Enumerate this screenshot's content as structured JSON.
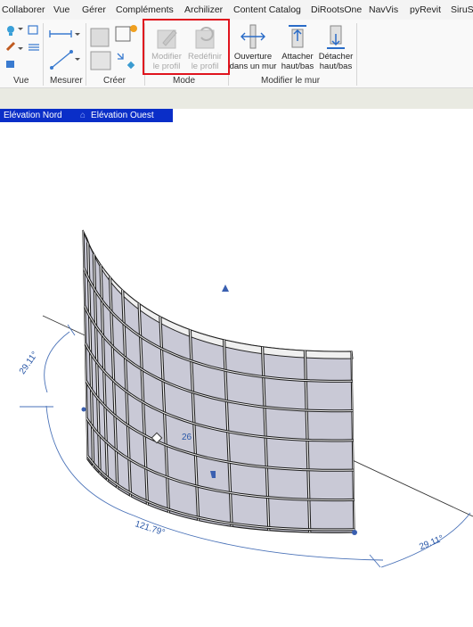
{
  "menu": [
    "Collaborer",
    "Vue",
    "Gérer",
    "Compléments",
    "Archilizer",
    "Content Catalog",
    "DiRootsOne",
    "NavVis",
    "pyRevit",
    "SiruS"
  ],
  "ribbon": {
    "panels": {
      "vue": "Vue",
      "mesurer": "Mesurer",
      "creer": "Créer",
      "mode": "Mode",
      "modifier_mur": "Modifier le mur"
    },
    "buttons": {
      "modifier_profil": [
        "Modifier",
        "le profil"
      ],
      "redefinir_profil": [
        "Redéfinir",
        "le profil"
      ],
      "ouverture": [
        "Ouverture",
        "dans un mur"
      ],
      "attacher": [
        "Attacher",
        "haut/bas"
      ],
      "detacher": [
        "Détacher",
        "haut/bas"
      ]
    }
  },
  "view_tabs": [
    "Elévation Nord",
    "Elévation Ouest"
  ],
  "colors": {
    "tab_active": "#0a2ec8",
    "highlight": "#e0141e",
    "dimension": "#4a72b8",
    "glass": "#c9c9d6"
  },
  "dimensions": {
    "angle_left": "29.11°",
    "angle_bottom": "121.79°",
    "angle_right": "29.11°",
    "radius_label": "26"
  }
}
